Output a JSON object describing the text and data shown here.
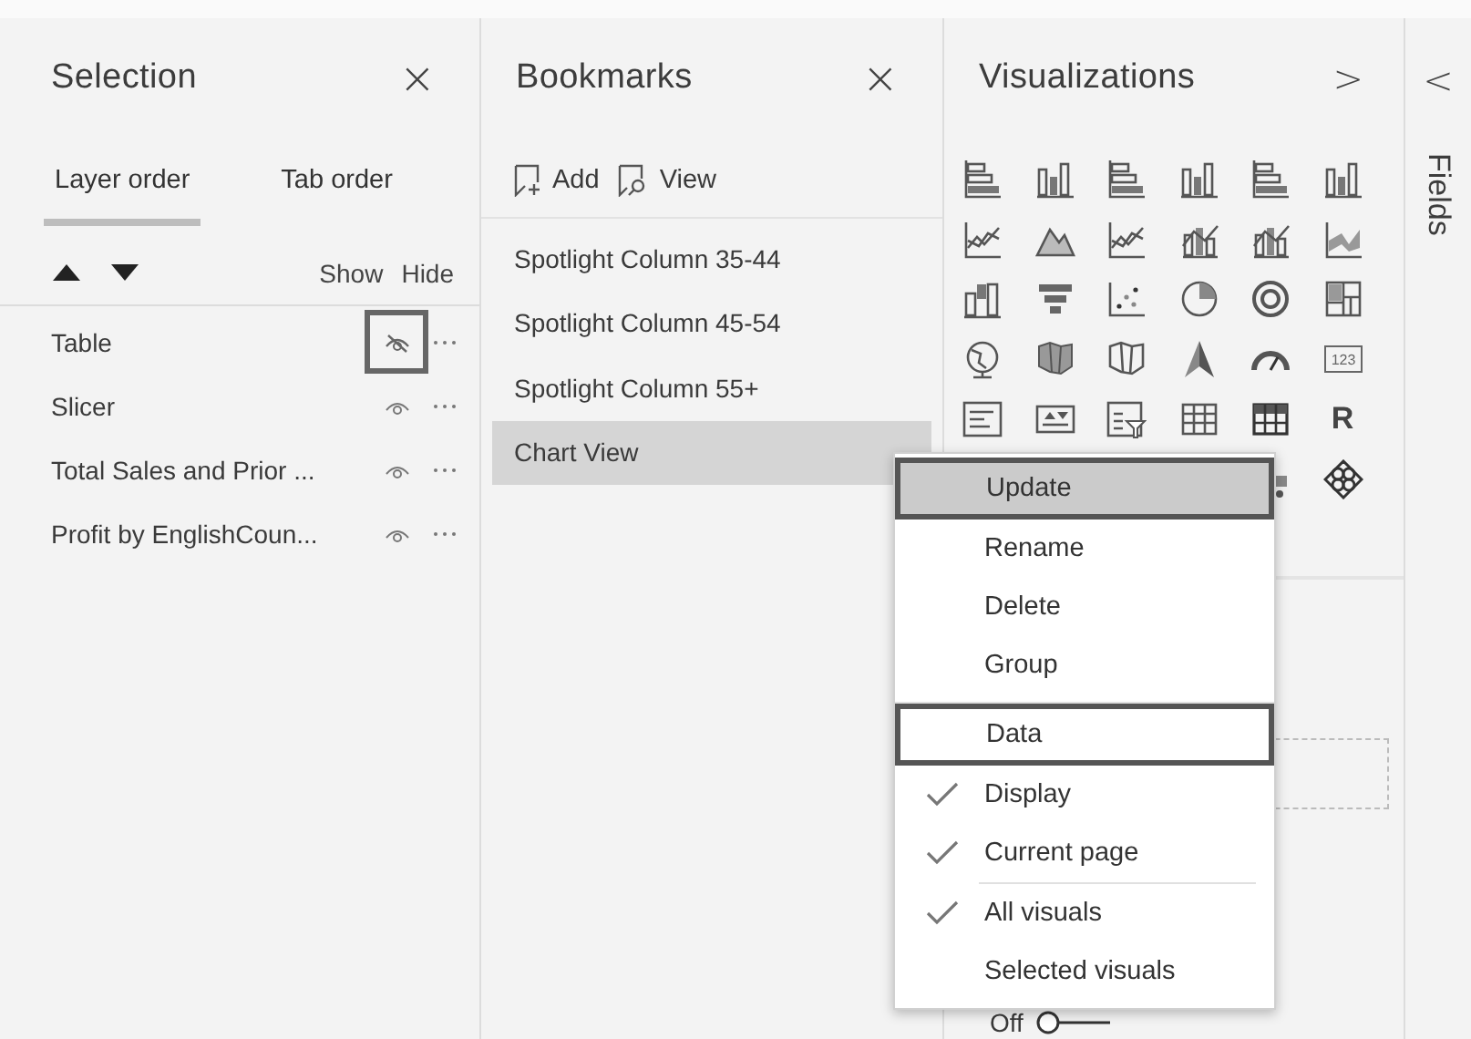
{
  "selection": {
    "title": "Selection",
    "close": "×",
    "tabs": [
      {
        "label": "Layer order",
        "selected": true
      },
      {
        "label": "Tab order",
        "selected": false
      }
    ],
    "show": "Show",
    "hide": "Hide",
    "layers": [
      {
        "name": "Table",
        "visible": false,
        "outlined": true
      },
      {
        "name": "Slicer",
        "visible": true,
        "outlined": false
      },
      {
        "name": "Total Sales and Prior ...",
        "visible": true,
        "outlined": false
      },
      {
        "name": "Profit by EnglishCoun...",
        "visible": true,
        "outlined": false
      }
    ]
  },
  "bookmarks": {
    "title": "Bookmarks",
    "close": "×",
    "add": "Add",
    "view": "View",
    "items": [
      {
        "label": "Spotlight Column 35-44",
        "selected": false
      },
      {
        "label": "Spotlight Column 45-54",
        "selected": false
      },
      {
        "label": "Spotlight Column 55+",
        "selected": false
      },
      {
        "label": "Chart View",
        "selected": true
      }
    ]
  },
  "visualizations": {
    "title": "Visualizations",
    "collapse": ">",
    "icons": [
      {
        "kind": "hbar"
      },
      {
        "kind": "column"
      },
      {
        "kind": "hbar"
      },
      {
        "kind": "column"
      },
      {
        "kind": "hbar"
      },
      {
        "kind": "column"
      },
      {
        "kind": "line"
      },
      {
        "kind": "area"
      },
      {
        "kind": "line"
      },
      {
        "kind": "combo"
      },
      {
        "kind": "combo"
      },
      {
        "kind": "ribbon"
      },
      {
        "kind": "waterfall"
      },
      {
        "kind": "funnel"
      },
      {
        "kind": "scatter"
      },
      {
        "kind": "pie"
      },
      {
        "kind": "donut"
      },
      {
        "kind": "treemap"
      },
      {
        "kind": "globe"
      },
      {
        "kind": "filledmap"
      },
      {
        "kind": "shapemap"
      },
      {
        "kind": "arrow"
      },
      {
        "kind": "gauge"
      },
      {
        "kind": "card",
        "text": "123"
      },
      {
        "kind": "multirow"
      },
      {
        "kind": "kpi"
      },
      {
        "kind": "slicer"
      },
      {
        "kind": "table"
      },
      {
        "kind": "matrix"
      },
      {
        "kind": "letter",
        "text": "R"
      },
      {
        "kind": "decomp"
      },
      {
        "kind": "diamond"
      }
    ],
    "toggle": {
      "label": "Off",
      "on": false
    }
  },
  "fields": {
    "expand": "<",
    "title": "Fields"
  },
  "context_menu": {
    "items": [
      {
        "kind": "item",
        "label": "Update",
        "selected": true,
        "outlined": true
      },
      {
        "kind": "item",
        "label": "Rename",
        "selected": false,
        "outlined": false
      },
      {
        "kind": "item",
        "label": "Delete",
        "selected": false,
        "outlined": false
      },
      {
        "kind": "item",
        "label": "Group",
        "selected": false,
        "outlined": false
      },
      {
        "kind": "separator"
      },
      {
        "kind": "item",
        "label": "Data",
        "selected": false,
        "outlined": true
      },
      {
        "kind": "check",
        "label": "Display",
        "checked": true,
        "selected": false,
        "outlined": false
      },
      {
        "kind": "check",
        "label": "Current page",
        "checked": true,
        "selected": false,
        "outlined": false
      },
      {
        "kind": "separator"
      },
      {
        "kind": "check",
        "label": "All visuals",
        "checked": true,
        "selected": false,
        "outlined": false
      },
      {
        "kind": "check",
        "label": "Selected visuals",
        "checked": false,
        "selected": false,
        "outlined": false
      }
    ]
  }
}
